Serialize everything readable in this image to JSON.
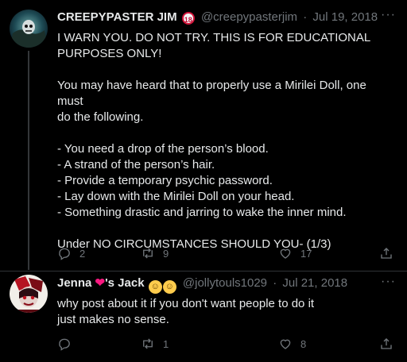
{
  "tweets": [
    {
      "display_name": "CREEPYPASTER JIM",
      "badge": "18",
      "handle": "@creepypasterjim",
      "separator": "·",
      "date": "Jul 19, 2018",
      "more": "···",
      "text": "I WARN YOU. DO NOT TRY. THIS IS FOR EDUCATIONAL\nPURPOSES ONLY!\n\nYou may have heard that to properly use a Mirilei Doll, one must\ndo the following.\n\n- You need a drop of the person’s blood.\n- A strand of the person’s hair.\n- Provide a temporary psychic password.\n- Lay down with the Mirilei Doll on your head.\n- Something drastic and jarring to wake the inner mind.\n\nUnder NO CIRCUMSTANCES SHOULD YOU- (1/3)",
      "replies": "2",
      "retweets": "9",
      "likes": "17"
    },
    {
      "display_name_part1": "Jenna ",
      "display_name_heart": "❤",
      "display_name_part2": "'s Jack ",
      "emoji1": "☺",
      "emoji2": "☺",
      "handle": "@jollytouls1029",
      "separator": "·",
      "date": "Jul 21, 2018",
      "more": "···",
      "text": "why post about it if you don't want people to do it\njust makes no sense.",
      "replies": "",
      "retweets": "1",
      "likes": "8"
    }
  ],
  "colors": {
    "background": "#000000",
    "text": "#e7e9ea",
    "muted": "#71767b",
    "divider": "#2f3336"
  }
}
